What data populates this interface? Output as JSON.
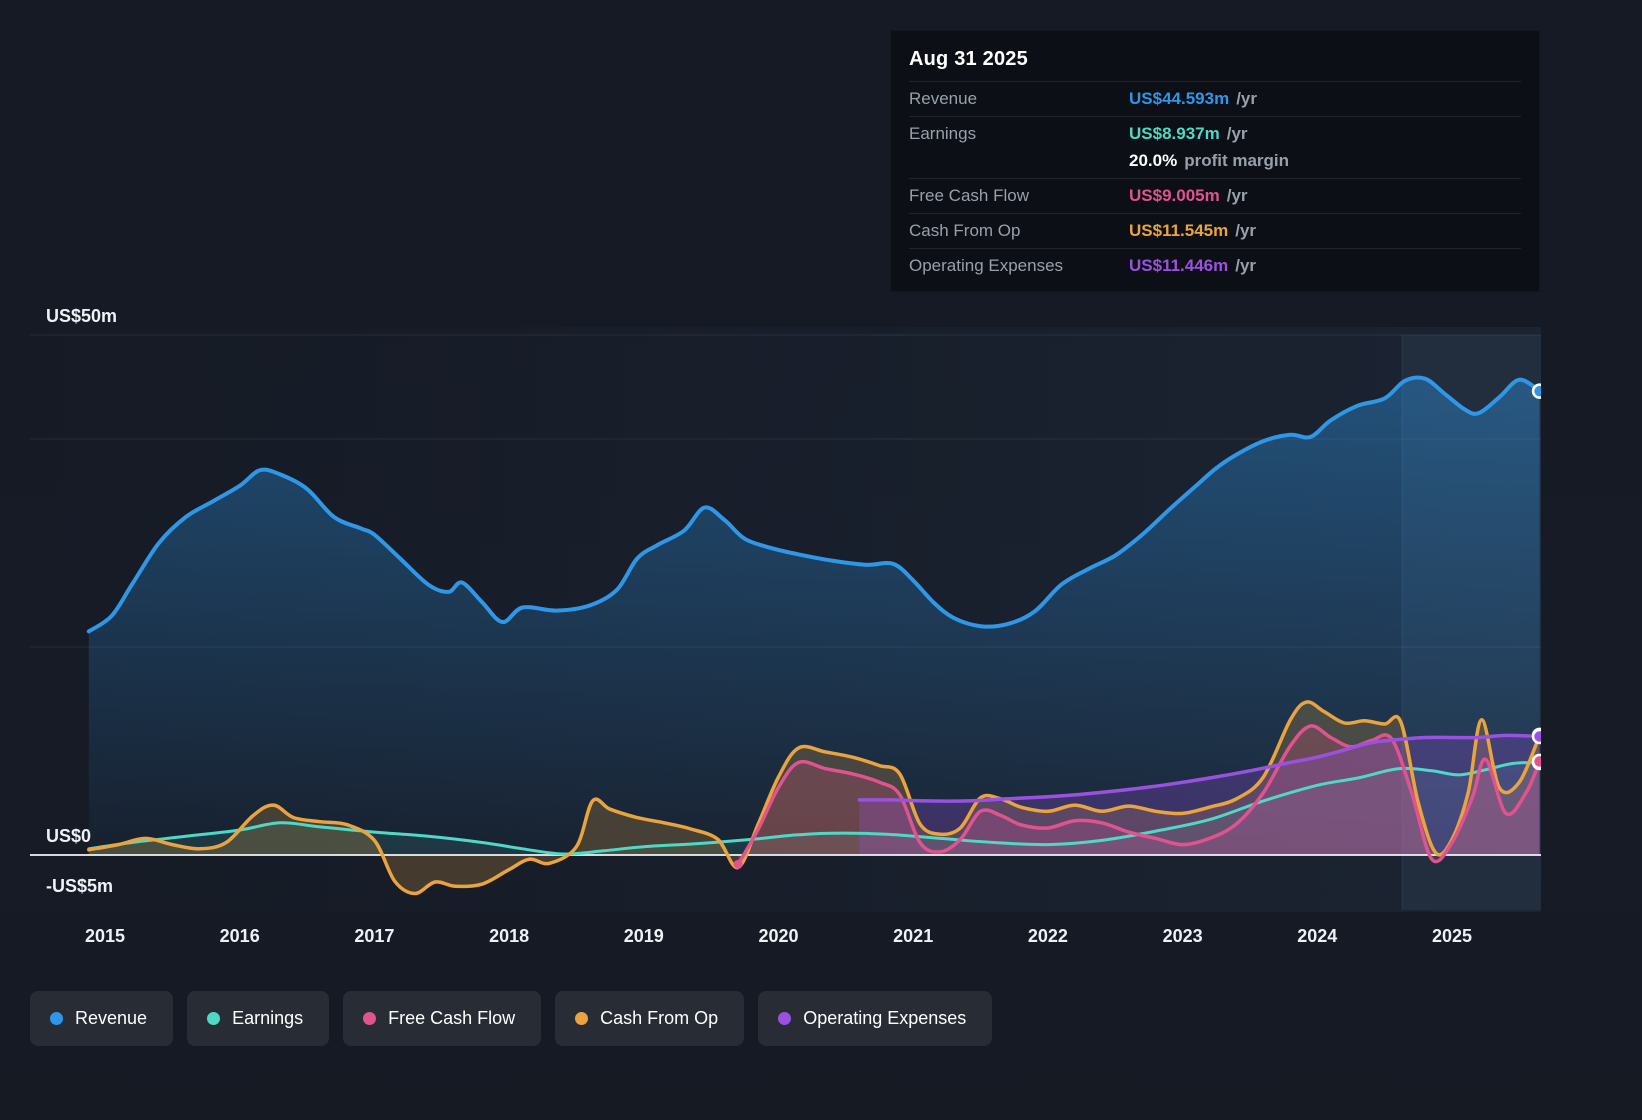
{
  "tooltip": {
    "date": "Aug 31 2025",
    "rows": [
      {
        "label": "Revenue",
        "value": "US$44.593m",
        "suffix": "/yr",
        "color": "#2f97e8",
        "divider": true
      },
      {
        "label": "Earnings",
        "value": "US$8.937m",
        "suffix": "/yr",
        "color": "#4fd8c6",
        "divider": true
      },
      {
        "label": "",
        "value": "20.0%",
        "suffix": "profit margin",
        "color": "#ffffff",
        "divider": false
      },
      {
        "label": "Free Cash Flow",
        "value": "US$9.005m",
        "suffix": "/yr",
        "color": "#e0538f",
        "divider": true
      },
      {
        "label": "Cash From Op",
        "value": "US$11.545m",
        "suffix": "/yr",
        "color": "#eaa43e",
        "divider": true
      },
      {
        "label": "Operating Expenses",
        "value": "US$11.446m",
        "suffix": "/yr",
        "color": "#9b51e0",
        "divider": true
      }
    ]
  },
  "legend": [
    {
      "label": "Revenue",
      "color": "#2f97e8"
    },
    {
      "label": "Earnings",
      "color": "#4fd8c6"
    },
    {
      "label": "Free Cash Flow",
      "color": "#e0538f"
    },
    {
      "label": "Cash From Op",
      "color": "#eaa43e"
    },
    {
      "label": "Operating Expenses",
      "color": "#9b51e0"
    }
  ],
  "chart_data": {
    "type": "line",
    "title": "Company financial history and analyst forecast",
    "unit": "US$ millions per year",
    "x_axis": {
      "min": 2014.88,
      "max": 2025.67,
      "ticks": [
        {
          "year": 2015,
          "label": "2015"
        },
        {
          "year": 2016,
          "label": "2016"
        },
        {
          "year": 2017,
          "label": "2017"
        },
        {
          "year": 2018,
          "label": "2018"
        },
        {
          "year": 2019,
          "label": "2019"
        },
        {
          "year": 2020,
          "label": "2020"
        },
        {
          "year": 2021,
          "label": "2021"
        },
        {
          "year": 2022,
          "label": "2022"
        },
        {
          "year": 2023,
          "label": "2023"
        },
        {
          "year": 2024,
          "label": "2024"
        },
        {
          "year": 2025,
          "label": "2025"
        }
      ]
    },
    "y_axis": {
      "min": -5,
      "max": 50,
      "gridlines": [
        50,
        40,
        20
      ],
      "labels": [
        {
          "value": 50,
          "text": "US$50m"
        },
        {
          "value": 0,
          "text": "US$0"
        },
        {
          "value": -5,
          "text": "-US$5m"
        }
      ]
    },
    "highlight_from": 2024.63,
    "series": [
      {
        "name": "Revenue",
        "color": "#2f97e8",
        "points": [
          [
            2014.88,
            21.5
          ],
          [
            2015.05,
            23.0
          ],
          [
            2015.2,
            26.0
          ],
          [
            2015.4,
            30.0
          ],
          [
            2015.6,
            32.5
          ],
          [
            2015.8,
            34.0
          ],
          [
            2016.0,
            35.5
          ],
          [
            2016.15,
            37.0
          ],
          [
            2016.3,
            36.6
          ],
          [
            2016.5,
            35.2
          ],
          [
            2016.7,
            32.5
          ],
          [
            2016.9,
            31.4
          ],
          [
            2017.0,
            30.8
          ],
          [
            2017.2,
            28.4
          ],
          [
            2017.4,
            26.0
          ],
          [
            2017.55,
            25.3
          ],
          [
            2017.65,
            26.2
          ],
          [
            2017.8,
            24.3
          ],
          [
            2017.95,
            22.4
          ],
          [
            2018.1,
            23.8
          ],
          [
            2018.35,
            23.5
          ],
          [
            2018.6,
            24.0
          ],
          [
            2018.8,
            25.5
          ],
          [
            2018.95,
            28.5
          ],
          [
            2019.1,
            29.8
          ],
          [
            2019.3,
            31.2
          ],
          [
            2019.45,
            33.4
          ],
          [
            2019.6,
            32.2
          ],
          [
            2019.75,
            30.4
          ],
          [
            2019.95,
            29.5
          ],
          [
            2020.15,
            28.9
          ],
          [
            2020.4,
            28.3
          ],
          [
            2020.65,
            27.9
          ],
          [
            2020.85,
            28.0
          ],
          [
            2021.0,
            26.4
          ],
          [
            2021.15,
            24.3
          ],
          [
            2021.3,
            22.8
          ],
          [
            2021.5,
            22.0
          ],
          [
            2021.7,
            22.2
          ],
          [
            2021.9,
            23.4
          ],
          [
            2022.1,
            26.0
          ],
          [
            2022.3,
            27.5
          ],
          [
            2022.5,
            28.8
          ],
          [
            2022.7,
            30.8
          ],
          [
            2022.9,
            33.2
          ],
          [
            2023.1,
            35.5
          ],
          [
            2023.25,
            37.2
          ],
          [
            2023.4,
            38.5
          ],
          [
            2023.6,
            39.8
          ],
          [
            2023.8,
            40.4
          ],
          [
            2023.95,
            40.2
          ],
          [
            2024.1,
            41.8
          ],
          [
            2024.3,
            43.2
          ],
          [
            2024.5,
            43.9
          ],
          [
            2024.65,
            45.6
          ],
          [
            2024.8,
            45.8
          ],
          [
            2024.95,
            44.3
          ],
          [
            2025.1,
            42.8
          ],
          [
            2025.2,
            42.5
          ],
          [
            2025.35,
            44.0
          ],
          [
            2025.5,
            45.7
          ],
          [
            2025.65,
            44.6
          ]
        ]
      },
      {
        "name": "Earnings",
        "color": "#4fd8c6",
        "points": [
          [
            2014.88,
            0.6
          ],
          [
            2015.2,
            1.2
          ],
          [
            2015.6,
            1.8
          ],
          [
            2016.0,
            2.4
          ],
          [
            2016.3,
            3.1
          ],
          [
            2016.6,
            2.7
          ],
          [
            2017.0,
            2.2
          ],
          [
            2017.4,
            1.8
          ],
          [
            2017.8,
            1.2
          ],
          [
            2018.1,
            0.6
          ],
          [
            2018.4,
            0.1
          ],
          [
            2018.7,
            0.4
          ],
          [
            2019.0,
            0.8
          ],
          [
            2019.4,
            1.1
          ],
          [
            2019.8,
            1.5
          ],
          [
            2020.1,
            1.9
          ],
          [
            2020.4,
            2.1
          ],
          [
            2020.8,
            2.0
          ],
          [
            2021.2,
            1.6
          ],
          [
            2021.6,
            1.2
          ],
          [
            2022.0,
            1.0
          ],
          [
            2022.4,
            1.4
          ],
          [
            2022.8,
            2.3
          ],
          [
            2023.2,
            3.4
          ],
          [
            2023.6,
            5.2
          ],
          [
            2024.0,
            6.7
          ],
          [
            2024.3,
            7.4
          ],
          [
            2024.6,
            8.3
          ],
          [
            2024.85,
            8.1
          ],
          [
            2025.05,
            7.7
          ],
          [
            2025.25,
            8.2
          ],
          [
            2025.45,
            8.8
          ],
          [
            2025.65,
            8.9
          ]
        ]
      },
      {
        "name": "Free Cash Flow",
        "color": "#e0538f",
        "points": [
          [
            2019.7,
            -0.9
          ],
          [
            2019.85,
            2.5
          ],
          [
            2020.0,
            6.5
          ],
          [
            2020.15,
            8.9
          ],
          [
            2020.35,
            8.3
          ],
          [
            2020.55,
            7.8
          ],
          [
            2020.75,
            7.0
          ],
          [
            2020.9,
            5.8
          ],
          [
            2021.05,
            1.2
          ],
          [
            2021.2,
            0.3
          ],
          [
            2021.35,
            1.5
          ],
          [
            2021.5,
            4.2
          ],
          [
            2021.65,
            3.8
          ],
          [
            2021.8,
            2.9
          ],
          [
            2022.0,
            2.6
          ],
          [
            2022.2,
            3.3
          ],
          [
            2022.4,
            3.1
          ],
          [
            2022.6,
            2.2
          ],
          [
            2022.8,
            1.6
          ],
          [
            2023.0,
            1.0
          ],
          [
            2023.2,
            1.6
          ],
          [
            2023.4,
            3.0
          ],
          [
            2023.6,
            6.0
          ],
          [
            2023.8,
            10.5
          ],
          [
            2023.95,
            12.4
          ],
          [
            2024.1,
            11.3
          ],
          [
            2024.25,
            10.4
          ],
          [
            2024.4,
            11.0
          ],
          [
            2024.55,
            11.2
          ],
          [
            2024.7,
            6.0
          ],
          [
            2024.85,
            -0.4
          ],
          [
            2025.0,
            1.2
          ],
          [
            2025.15,
            5.5
          ],
          [
            2025.25,
            9.2
          ],
          [
            2025.4,
            4.0
          ],
          [
            2025.55,
            6.0
          ],
          [
            2025.65,
            9.0
          ]
        ]
      },
      {
        "name": "Cash From Op",
        "color": "#eaa43e",
        "points": [
          [
            2014.88,
            0.5
          ],
          [
            2015.1,
            1.0
          ],
          [
            2015.3,
            1.6
          ],
          [
            2015.5,
            1.0
          ],
          [
            2015.7,
            0.6
          ],
          [
            2015.9,
            1.2
          ],
          [
            2016.1,
            3.8
          ],
          [
            2016.25,
            4.8
          ],
          [
            2016.4,
            3.6
          ],
          [
            2016.6,
            3.2
          ],
          [
            2016.8,
            2.9
          ],
          [
            2017.0,
            1.4
          ],
          [
            2017.15,
            -2.5
          ],
          [
            2017.3,
            -3.7
          ],
          [
            2017.45,
            -2.6
          ],
          [
            2017.6,
            -3.0
          ],
          [
            2017.8,
            -2.8
          ],
          [
            2018.0,
            -1.4
          ],
          [
            2018.15,
            -0.4
          ],
          [
            2018.3,
            -0.8
          ],
          [
            2018.5,
            0.8
          ],
          [
            2018.62,
            5.2
          ],
          [
            2018.75,
            4.4
          ],
          [
            2018.95,
            3.6
          ],
          [
            2019.15,
            3.1
          ],
          [
            2019.35,
            2.5
          ],
          [
            2019.55,
            1.5
          ],
          [
            2019.7,
            -1.2
          ],
          [
            2019.85,
            3.0
          ],
          [
            2020.0,
            7.5
          ],
          [
            2020.15,
            10.3
          ],
          [
            2020.35,
            9.9
          ],
          [
            2020.55,
            9.4
          ],
          [
            2020.75,
            8.6
          ],
          [
            2020.9,
            7.8
          ],
          [
            2021.05,
            3.0
          ],
          [
            2021.2,
            2.0
          ],
          [
            2021.35,
            2.6
          ],
          [
            2021.5,
            5.5
          ],
          [
            2021.65,
            5.4
          ],
          [
            2021.8,
            4.6
          ],
          [
            2022.0,
            4.2
          ],
          [
            2022.2,
            4.8
          ],
          [
            2022.4,
            4.2
          ],
          [
            2022.6,
            4.7
          ],
          [
            2022.8,
            4.2
          ],
          [
            2023.0,
            4.0
          ],
          [
            2023.2,
            4.6
          ],
          [
            2023.4,
            5.4
          ],
          [
            2023.6,
            7.5
          ],
          [
            2023.8,
            13.0
          ],
          [
            2023.92,
            14.7
          ],
          [
            2024.05,
            13.8
          ],
          [
            2024.2,
            12.7
          ],
          [
            2024.35,
            12.9
          ],
          [
            2024.5,
            12.6
          ],
          [
            2024.62,
            12.8
          ],
          [
            2024.75,
            5.0
          ],
          [
            2024.88,
            0.2
          ],
          [
            2025.0,
            1.5
          ],
          [
            2025.12,
            6.0
          ],
          [
            2025.22,
            13.0
          ],
          [
            2025.35,
            6.5
          ],
          [
            2025.5,
            7.0
          ],
          [
            2025.65,
            11.5
          ]
        ]
      },
      {
        "name": "Operating Expenses",
        "color": "#9b51e0",
        "points": [
          [
            2020.6,
            5.3
          ],
          [
            2020.85,
            5.3
          ],
          [
            2021.1,
            5.2
          ],
          [
            2021.4,
            5.2
          ],
          [
            2021.7,
            5.4
          ],
          [
            2022.0,
            5.6
          ],
          [
            2022.3,
            5.9
          ],
          [
            2022.6,
            6.3
          ],
          [
            2022.9,
            6.8
          ],
          [
            2023.2,
            7.4
          ],
          [
            2023.5,
            8.1
          ],
          [
            2023.8,
            8.9
          ],
          [
            2024.0,
            9.4
          ],
          [
            2024.2,
            10.1
          ],
          [
            2024.4,
            10.8
          ],
          [
            2024.6,
            11.1
          ],
          [
            2024.8,
            11.3
          ],
          [
            2025.0,
            11.3
          ],
          [
            2025.2,
            11.3
          ],
          [
            2025.4,
            11.5
          ],
          [
            2025.65,
            11.4
          ]
        ]
      }
    ]
  }
}
